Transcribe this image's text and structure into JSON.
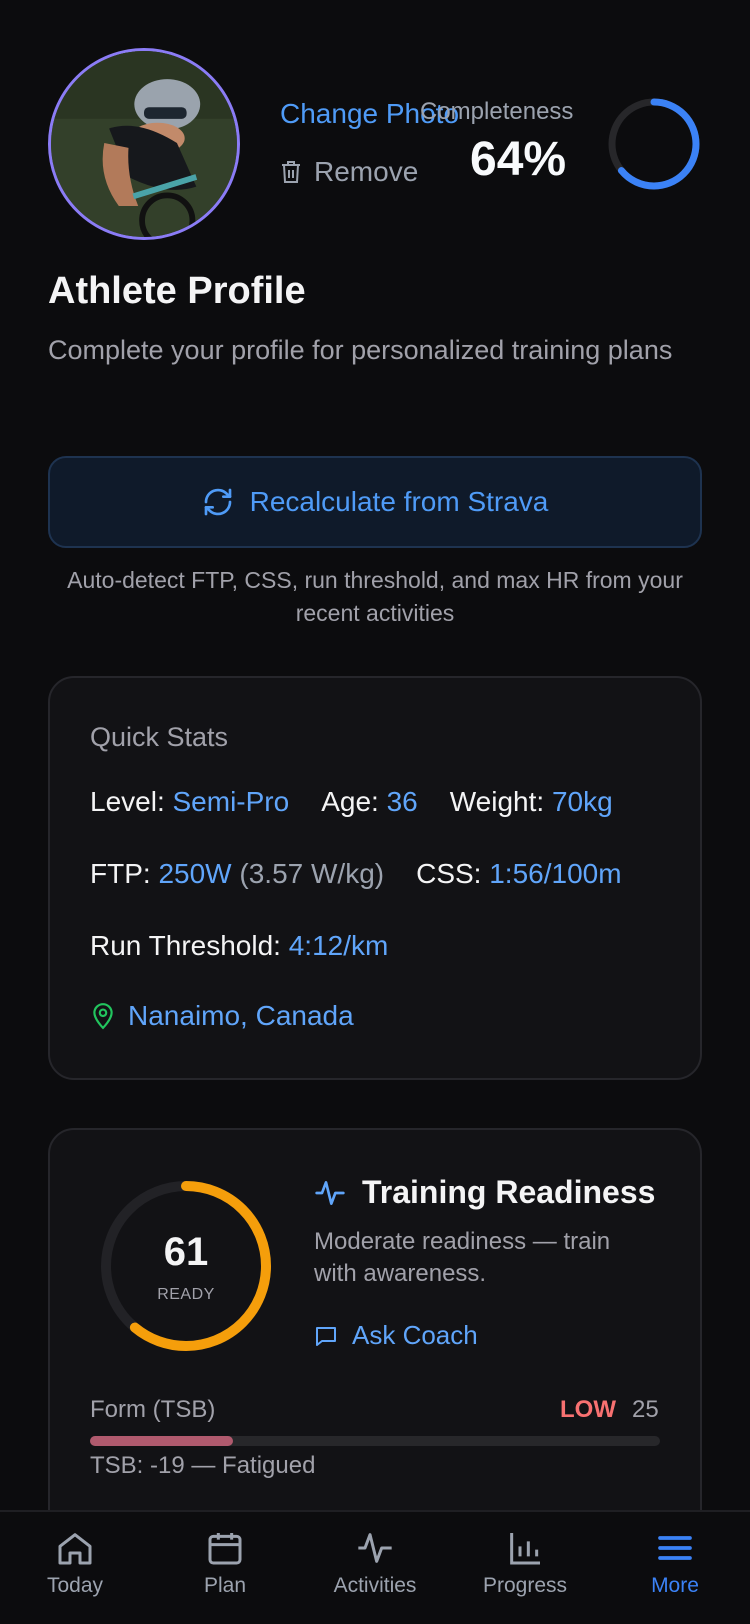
{
  "header": {
    "change_photo": "Change Photo",
    "remove": "Remove",
    "completeness_label": "Completeness",
    "completeness_value": "64%",
    "completeness_percent": 64
  },
  "page": {
    "title": "Athlete Profile",
    "subtitle": "Complete your profile for personalized training plans"
  },
  "strava": {
    "button_label": "Recalculate from Strava",
    "help": "Auto-detect FTP, CSS, run threshold, and max HR from your recent activities"
  },
  "quick_stats": {
    "title": "Quick Stats",
    "level_label": "Level:",
    "level_value": "Semi-Pro",
    "age_label": "Age:",
    "age_value": "36",
    "weight_label": "Weight:",
    "weight_value": "70kg",
    "ftp_label": "FTP:",
    "ftp_value": "250W",
    "ftp_wkg": "(3.57 W/kg)",
    "css_label": "CSS:",
    "css_value": "1:56/100m",
    "run_label": "Run Threshold:",
    "run_value": "4:12/km",
    "location": "Nanaimo, Canada"
  },
  "readiness": {
    "score": "61",
    "score_value": 61,
    "score_label": "READY",
    "title": "Training Readiness",
    "description": "Moderate readiness — train with awareness.",
    "ask_coach": "Ask Coach",
    "form_label": "Form (TSB)",
    "form_status": "LOW",
    "form_value": "25",
    "form_fill_percent": 25,
    "tsb_text": "TSB: -19 — Fatigued"
  },
  "colors": {
    "accent": "#3b82f6",
    "ring_orange": "#f59e0b",
    "low_red": "#f87171",
    "location_green": "#22c55e"
  },
  "nav": {
    "items": [
      {
        "label": "Today",
        "icon": "home-icon"
      },
      {
        "label": "Plan",
        "icon": "calendar-icon"
      },
      {
        "label": "Activities",
        "icon": "activity-icon"
      },
      {
        "label": "Progress",
        "icon": "bar-chart-icon"
      },
      {
        "label": "More",
        "icon": "menu-icon",
        "active": true
      }
    ]
  }
}
